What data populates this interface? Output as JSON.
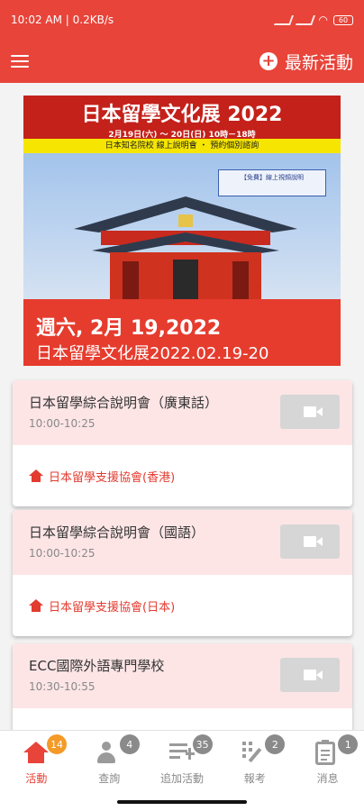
{
  "status": {
    "time_and_speed": "10:02 AM | 0.2KB/s",
    "battery": "60"
  },
  "appbar": {
    "new_activity_label": "最新活動"
  },
  "banner": {
    "poster_title": "日本留學文化展 2022",
    "poster_dates": "2月19日(六) ～ 20日(日) 10時－18時",
    "poster_tagline": "日本知名院校 線上說明會 ・ 預約個別諮詢",
    "poster_box": "【免費】線上視頻說明",
    "date": "週六, 2月 19,2022",
    "subtitle": "日本留學文化展2022.02.19-20"
  },
  "cards": [
    {
      "title": "日本留學綜合說明會（廣東話）",
      "time": "10:00-10:25",
      "organizer": "日本留學支援協會(香港)"
    },
    {
      "title": "日本留學綜合說明會（國語）",
      "time": "10:00-10:25",
      "organizer": "日本留學支援協會(日本)"
    },
    {
      "title": "ECC國際外語專門學校",
      "time": "10:30-10:55",
      "organizer": ""
    }
  ],
  "nav": [
    {
      "label": "活動",
      "badge": "14",
      "active": true
    },
    {
      "label": "查詢",
      "badge": "4"
    },
    {
      "label": "追加活動",
      "badge": "35"
    },
    {
      "label": "報考",
      "badge": "2"
    },
    {
      "label": "消息",
      "badge": "1"
    }
  ],
  "colors": {
    "primary": "#e8443a",
    "card_top": "#fde5e6",
    "badge_active": "#f39a28"
  }
}
